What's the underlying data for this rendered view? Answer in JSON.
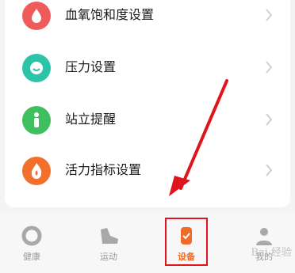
{
  "settings": {
    "items": [
      {
        "label": "血氧饱和度设置",
        "icon": "blood-oxygen-icon",
        "color": "#ef5b5b"
      },
      {
        "label": "压力设置",
        "icon": "stress-icon",
        "color": "#2cc4a8"
      },
      {
        "label": "站立提醒",
        "icon": "standing-icon",
        "color": "#3fbf5f"
      },
      {
        "label": "活力指标设置",
        "icon": "vitality-icon",
        "color": "#f26f2c"
      }
    ]
  },
  "nav": {
    "tabs": [
      {
        "label": "健康",
        "icon": "health-icon",
        "active": false
      },
      {
        "label": "运动",
        "icon": "sport-icon",
        "active": false
      },
      {
        "label": "设备",
        "icon": "device-icon",
        "active": true
      },
      {
        "label": "我的",
        "icon": "profile-icon",
        "active": false
      }
    ],
    "accent": "#f06a2a"
  },
  "annotation": {
    "arrow_color": "#e0141c",
    "box_color": "#e0141c"
  },
  "watermark": "Bai 经验"
}
